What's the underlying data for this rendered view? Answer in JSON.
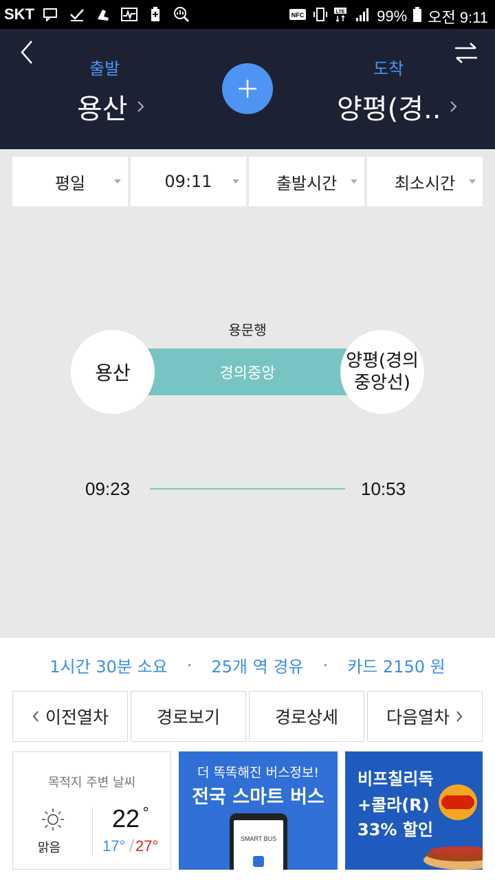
{
  "status_bar": {
    "carrier": "SKT",
    "battery": "99%",
    "time": "오전 9:11"
  },
  "header": {
    "departure_label": "출발",
    "departure_station": "용산",
    "arrival_label": "도착",
    "arrival_station": "양평(경.."
  },
  "filters": [
    {
      "label": "평일"
    },
    {
      "label": "09:11"
    },
    {
      "label": "출발시간"
    },
    {
      "label": "최소시간"
    }
  ],
  "route": {
    "direction": "용문행",
    "line_name": "경의중앙",
    "line_color": "#77c4c2",
    "start_station": "용산",
    "end_station_line1": "양평(경의",
    "end_station_line2": "중앙선)",
    "depart_time": "09:23",
    "arrive_time": "10:53"
  },
  "summary": {
    "duration": "1시간 30분 소요",
    "stops": "25개 역 경유",
    "fare": "카드 2150 원",
    "separator": "·"
  },
  "actions": {
    "prev": "이전열차",
    "route_view": "경로보기",
    "route_detail": "경로상세",
    "next": "다음열차"
  },
  "weather": {
    "title": "목적지 주변 날씨",
    "condition": "맑음",
    "temp": "22",
    "low": "17",
    "high": "27",
    "degree": "°"
  },
  "ad_bus": {
    "line1": "더 똑똑해진 버스정보!",
    "line2": "전국 스마트 버스",
    "phone_text": "SMART BUS"
  },
  "ad_burger": {
    "line1": "비프칠리독",
    "line2": "+콜라(R)",
    "line3": "33% 할인"
  },
  "colors": {
    "accent": "#4f94f2",
    "header_bg": "#1c2233",
    "summary_text": "#3a8ee6"
  }
}
